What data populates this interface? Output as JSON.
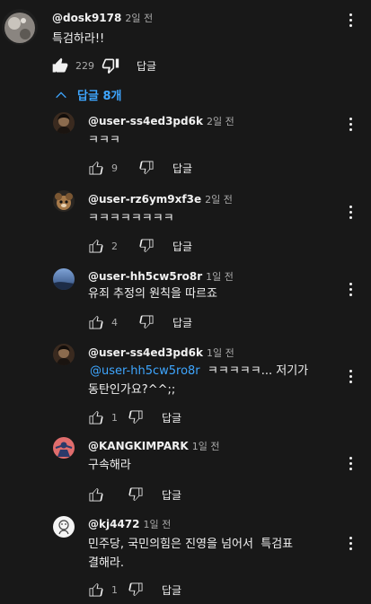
{
  "top_comment": {
    "author": "@dosk9178",
    "time": "2일 전",
    "text": "특검하라!!",
    "likes": "229",
    "reply_label": "답글"
  },
  "replies_toggle": {
    "label": "답글 8개"
  },
  "replies": [
    {
      "author": "@user-ss4ed3pd6k",
      "time": "2일 전",
      "text": "ㅋㅋㅋ",
      "likes": "9",
      "reply_label": "답글"
    },
    {
      "author": "@user-rz6ym9xf3e",
      "time": "2일 전",
      "text": "ㅋㅋㅋㅋㅋㅋㅋㅋ",
      "likes": "2",
      "reply_label": "답글"
    },
    {
      "author": "@user-hh5cw5ro8r",
      "time": "1일 전",
      "text": "유죄 추정의 원칙을 따르죠",
      "likes": "4",
      "reply_label": "답글"
    },
    {
      "author": "@user-ss4ed3pd6k",
      "time": "1일 전",
      "mention": "@user-hh5cw5ro8r",
      "text_after_mention": "  ㅋㅋㅋㅋㅋ... 저기가",
      "text_line2": "동탄인가요?^^;;",
      "likes": "1",
      "reply_label": "답글"
    },
    {
      "author": "@KANGKIMPARK",
      "time": "1일 전",
      "text": "구속해라",
      "likes": "",
      "reply_label": "답글"
    },
    {
      "author": "@kj4472",
      "time": "1일 전",
      "text": "민주당, 국민의힘은 진영을 넘어서  특검표",
      "text_line2": "결해라.",
      "likes": "1",
      "reply_label": "답글"
    }
  ],
  "icons": {
    "like": "thumbs-up-icon",
    "dislike": "thumbs-down-icon",
    "menu": "more-vert-icon",
    "toggle": "chevron-up-icon"
  },
  "colors": {
    "background": "#181818",
    "link": "#3ea6ff",
    "muted": "#aaaaaa"
  }
}
